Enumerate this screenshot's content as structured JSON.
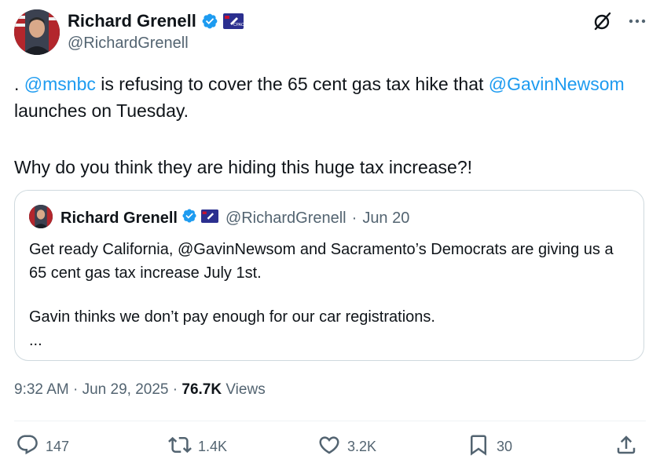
{
  "author": {
    "name": "Richard Grenell",
    "handle": "@RichardGrenell"
  },
  "tweet": {
    "segments": [
      {
        "text": ". ",
        "mention": false
      },
      {
        "text": "@msnbc",
        "mention": true
      },
      {
        "text": " is refusing to cover the 65 cent gas tax hike that ",
        "mention": false
      },
      {
        "text": "@GavinNewsom",
        "mention": true
      },
      {
        "text": " launches on Tuesday.",
        "mention": false
      }
    ],
    "second_paragraph": "Why do you think they are hiding this huge tax increase?!"
  },
  "quote": {
    "name": "Richard Grenell",
    "handle": "@RichardGrenell",
    "separator": "·",
    "date": "Jun 20",
    "line1": "Get ready California, @GavinNewsom and Sacramento’s Democrats are giving us a 65 cent gas tax increase July 1st.",
    "line2": "Gavin thinks we don’t pay enough for our car registrations.",
    "ellipsis": "..."
  },
  "meta": {
    "time": "9:32 AM",
    "sep1": " · ",
    "date": "Jun 29, 2025",
    "sep2": " · ",
    "views_count": "76.7K",
    "views_label": " Views"
  },
  "actions": {
    "replies": "147",
    "reposts": "1.4K",
    "likes": "3.2K",
    "bookmarks": "30"
  },
  "colors": {
    "accent": "#1d9bf0",
    "secondary_text": "#536471",
    "primary_text": "#0f1419",
    "border": "#cfd9de"
  },
  "icons": [
    "verified-icon",
    "org-badge-icon",
    "grok-icon",
    "more-icon",
    "reply-icon",
    "repost-icon",
    "like-icon",
    "bookmark-icon",
    "share-icon"
  ]
}
